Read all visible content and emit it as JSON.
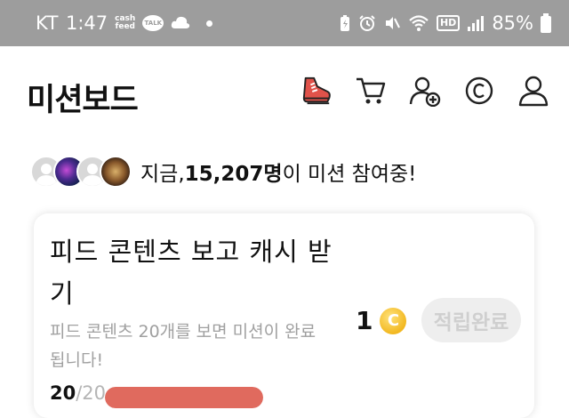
{
  "status_bar": {
    "carrier": "KT",
    "time": "1:47",
    "cashfeed_line1": "cash",
    "cashfeed_line2": "feed",
    "talk": "TALK",
    "hd": "HD",
    "battery": "85%"
  },
  "header": {
    "title": "미션보드",
    "icons": [
      "shoe-icon",
      "cart-icon",
      "add-friend-icon",
      "coin-icon",
      "user-icon"
    ]
  },
  "participants": {
    "prefix": "지금, ",
    "count": "15,207명",
    "suffix": "이 미션 참여중!"
  },
  "mission_card": {
    "title": "피드 콘텐츠 보고 캐시 받기",
    "description": "피드 콘텐츠 20개를 보면 미션이 완료됩니다!",
    "reward": "1",
    "coin_symbol": "C",
    "button_label": "적립완료",
    "progress_current": "20",
    "progress_total": "/20",
    "progress_fraction": 1.0
  },
  "colors": {
    "status_bar_bg": "#9d9d9d",
    "progress_fill": "#e06a5e",
    "coin": "#f2b821",
    "shoe_accent": "#e0524a"
  }
}
